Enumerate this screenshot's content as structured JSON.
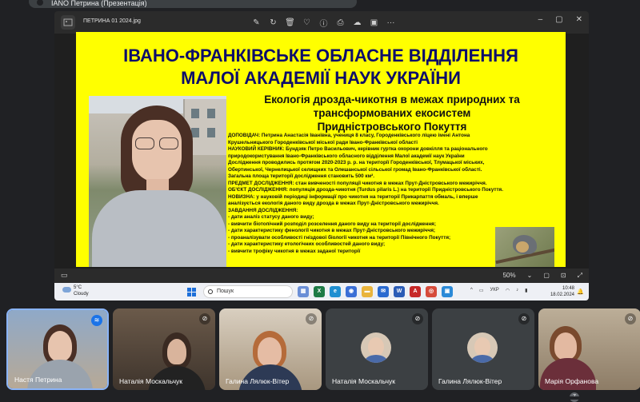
{
  "meeting": {
    "top_title": "IANO Петрина (Презентація)"
  },
  "viewer": {
    "file_name": "ПЕТРИНА 01 2024.jpg",
    "tools": [
      {
        "name": "edit-icon",
        "glyph": "✎"
      },
      {
        "name": "rotate-icon",
        "glyph": "↻"
      },
      {
        "name": "delete-icon",
        "glyph": "🗑"
      },
      {
        "name": "favorite-icon",
        "glyph": "♡"
      },
      {
        "name": "info-icon",
        "glyph": "ⓘ"
      },
      {
        "name": "print-icon",
        "glyph": "⎙"
      },
      {
        "name": "cloud-icon",
        "glyph": "☁"
      },
      {
        "name": "share-icon",
        "glyph": "▣"
      },
      {
        "name": "more-icon",
        "glyph": "···"
      }
    ],
    "window_controls": {
      "minimize": "–",
      "maximize": "▢",
      "close": "✕"
    },
    "zoom": "50%",
    "status_glyphs": [
      "⌄",
      "▢",
      "⊡",
      "⤢"
    ]
  },
  "slide": {
    "title_line1": "ІВАНО-ФРАНКІВСЬКЕ ОБЛАСНЕ ВІДДІЛЕННЯ",
    "title_line2": "МАЛОЇ АКАДЕМІЇ НАУК УКРАЇНИ",
    "subject_line1": "Екологія дрозда-чикотня в межах природних та",
    "subject_line2": "трансформованих екосистем",
    "subject_line3": "Придністровського Покуття",
    "body": [
      "ДОПОВІДАЧ: Петрина Анастасія Іванівна, учениця 8 класу, Городенківського ліцею імені Антона",
      "Крушельницького Городенківської міської ради Івано-Франківської області",
      "НАУКОВИЙ КЕРІВНИК: Бундзяк Петро Васильович, керівник гуртка охорони довкілля та раціонального",
      "природокористування Івано-Франківського обласного відділення Малої академії наук України",
      "Дослідження проводились протягом 2020-2023 р. р. на території Городенківської, Тлумацької міських,",
      "Обертинської, Чернелицької селищних та Олешанської сільської громад Івано-Франківської області.",
      "Загальна площа території дослідження становить 500 км².",
      "ПРЕДМЕТ ДОСЛІДЖЕННЯ: стан вивченості популяції чикотня в межах Прут-Дністровського межиріччя.",
      "ОБ'ЄКТ ДОСЛІДЖЕННЯ: популяція дрозда-чикотня (Turdus pilaris L.) на території Придністровського Покуття.",
      "НОВИЗНА: у науковій періодиці інформації про чикотня на території Прикарпаття обмаль, і вперше",
      "аналізується екологія даного виду дрозда в межах Прут-Дністровського межиріччя.",
      "ЗАВДАННЯ ДОСЛІДЖЕННЯ:",
      "- дати аналіз статусу даного виду;",
      "- вивчити біотопічний розподіл розселення даного виду на території дослідження;",
      "- дати характеристику фенології чикотня в межах Прут-Дністровського межиріччя;",
      "- проаналізувати особливості гніздової біології чикотня на території Північного Покуття;",
      "- дати характеристику етологічних особливостей даного виду;",
      "- вивчити трофіку чикотня в межах заданої території"
    ]
  },
  "taskbar": {
    "weather_temp": "5°C",
    "weather_desc": "Cloudy",
    "search_placeholder": "Пошук",
    "apps": [
      {
        "name": "files-app-icon",
        "label": "▦",
        "color": "#6b8fd6"
      },
      {
        "name": "excel-app-icon",
        "label": "X",
        "color": "#1d7a45"
      },
      {
        "name": "edge-app-icon",
        "label": "e",
        "color": "#1f8fd1"
      },
      {
        "name": "chat-app-icon",
        "label": "◉",
        "color": "#3b6fd6"
      },
      {
        "name": "explorer-app-icon",
        "label": "▬",
        "color": "#e9b43c"
      },
      {
        "name": "mail-app-icon",
        "label": "✉",
        "color": "#2a6ad0"
      },
      {
        "name": "word-app-icon",
        "label": "W",
        "color": "#2b5cb6"
      },
      {
        "name": "acrobat-app-icon",
        "label": "A",
        "color": "#c62828"
      },
      {
        "name": "chrome-app-icon",
        "label": "◎",
        "color": "#d64b3b"
      },
      {
        "name": "photos-app-icon",
        "label": "▣",
        "color": "#2b8ad8"
      }
    ],
    "tray": [
      "^",
      "▭",
      "УКР",
      "◠",
      "♪",
      "▮"
    ],
    "time": "10:48",
    "date": "18.02.2024"
  },
  "participants": [
    {
      "name": "Настя Петрина",
      "mic": "on"
    },
    {
      "name": "Наталія Москальчук",
      "mic": "off"
    },
    {
      "name": "Галина Лялюк-Вітер",
      "mic": "off"
    },
    {
      "name": "Наталія Москальчук",
      "mic": "off"
    },
    {
      "name": "Галина Лялюк-Вітер",
      "mic": "off"
    },
    {
      "name": "Марія Орфанова",
      "mic": "off"
    }
  ],
  "participants_more_count": "7"
}
